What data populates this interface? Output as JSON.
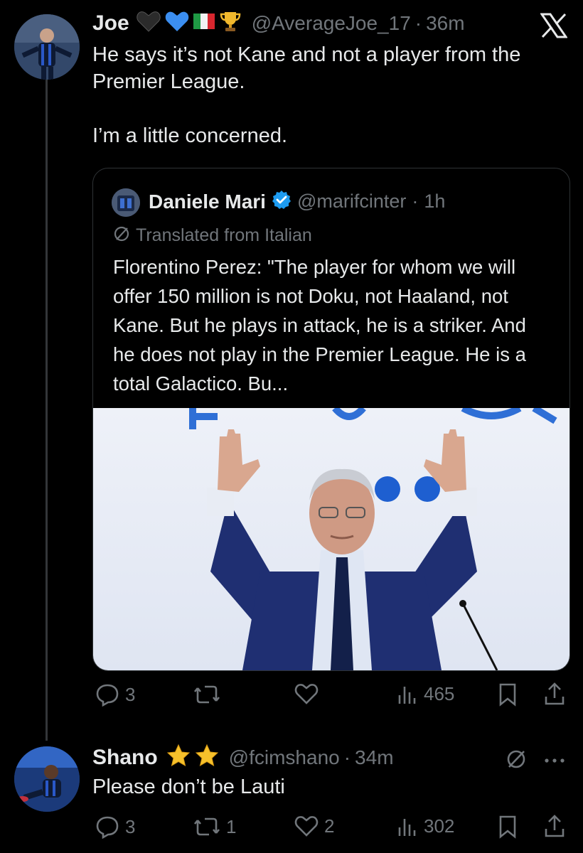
{
  "tweet1": {
    "name": "Joe",
    "badges": [
      "black-heart-icon",
      "blue-heart-icon",
      "italy-flag-icon",
      "trophy-icon"
    ],
    "handle": "@AverageJoe_17",
    "dot": "·",
    "time": "36m",
    "text": "He says it’s not Kane and not a player from the Premier League.\n\nI’m a little concerned.",
    "actions": {
      "replies": "3",
      "reposts": "",
      "likes": "",
      "views": "465"
    }
  },
  "quote": {
    "name": "Daniele Mari",
    "handle": "@marifcinter",
    "dot": "·",
    "time": "1h",
    "translated": "Translated from Italian",
    "text": "Florentino Perez: \"The player for whom we will offer 150 million is not Doku, not Haaland, not Kane. But he plays in attack, he is a striker. And he does not play in the Premier League. He is a total Galactico. Bu..."
  },
  "tweet2": {
    "name": "Shano",
    "badges": [
      "star-icon",
      "star-icon"
    ],
    "handle": "@fcimshano",
    "dot": "·",
    "time": "34m",
    "text": "Please don’t be Lauti",
    "actions": {
      "replies": "3",
      "reposts": "1",
      "likes": "2",
      "views": "302"
    }
  },
  "colors": {
    "background": "#000000",
    "text": "#e7e9ea",
    "muted": "#71767b",
    "verified": "#1d9bf0"
  }
}
